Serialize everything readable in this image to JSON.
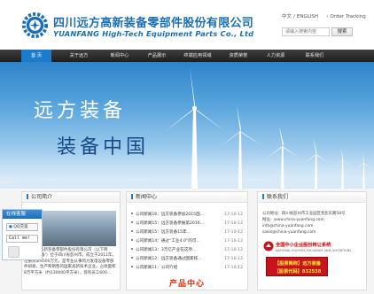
{
  "header": {
    "logo_cn": "四川远方高新装备零部件股份有限公司",
    "logo_en": "YUANFANG High-Tech Equipment Parts Co., Ltd",
    "lang_cn": "中文",
    "lang_sep": "/",
    "lang_en": "ENGLISH",
    "order_tracking": "Order Tracking",
    "search_placeholder": "请输入搜索内容",
    "search_button": "搜索"
  },
  "nav": {
    "items": [
      "首 页",
      "关于远方",
      "新闻中心",
      "产品展示",
      "终端应用领域",
      "资质荣誉",
      "人力资源",
      "联系我们"
    ],
    "active_index": 0
  },
  "banner": {
    "slogan_line1": "远方装备",
    "slogan_line2": "装备中国"
  },
  "about": {
    "title": "公司简介",
    "text": "四川远方高新装备零部件股份有限公司（以下简称'远方装备'）位于四川省彭州市，成立于2011年，注册资本4000万元，是专业从事风力发电设备零部件研发、生产和销售的国家高新技术企业，占地面积8万平方米（约130000平方米），现有员工600..."
  },
  "float_service": {
    "title": "在线客服",
    "qq_label": "QQ交谈",
    "call_label": "Call me!"
  },
  "news": {
    "title": "新闻中心",
    "items": [
      {
        "title": "公司新闻16：远方装备参加2015国...",
        "date": "17-10-12"
      },
      {
        "title": "公司新闻15：远方装备参展第2016...",
        "date": "17-10-12"
      },
      {
        "title": "公司新闻15：远方装备15年...",
        "date": "17-10-12"
      },
      {
        "title": "公司新闻14：通过“工业4.0”的可...",
        "date": "17-10-12"
      },
      {
        "title": "公司新闻13：3万亿产业在这项...",
        "date": "17-10-12"
      },
      {
        "title": "公司新闻12：远方装备通过国家技...",
        "date": "17-10-12"
      },
      {
        "title": "公司新闻11：公司介绍",
        "date": "17-10-12"
      }
    ]
  },
  "contact": {
    "title": "联系我们",
    "lines": [
      "公司地址：四川省彭州市工业园区金彭东路58号",
      "网址：www.china-yuanfang.com",
      "info@china-yuanfang.com",
      "sales@china-yuanfang.com"
    ],
    "cert_title": "全国中小企业股份转让系统",
    "cert_sub": "NATIONAL EQUITIES EXCHANGE AND QUOTATIONS",
    "stock_abbr_label": "【股票简称】",
    "stock_abbr": "远方装备",
    "stock_code_label": "【股票代码】",
    "stock_code": "832538"
  },
  "products": {
    "title": "产品中心"
  },
  "colors": {
    "brand_blue": "#1a6fb6",
    "nav_active": "#1b7ccc",
    "product_title": "#e0320f",
    "stock_red": "#c8151b"
  }
}
